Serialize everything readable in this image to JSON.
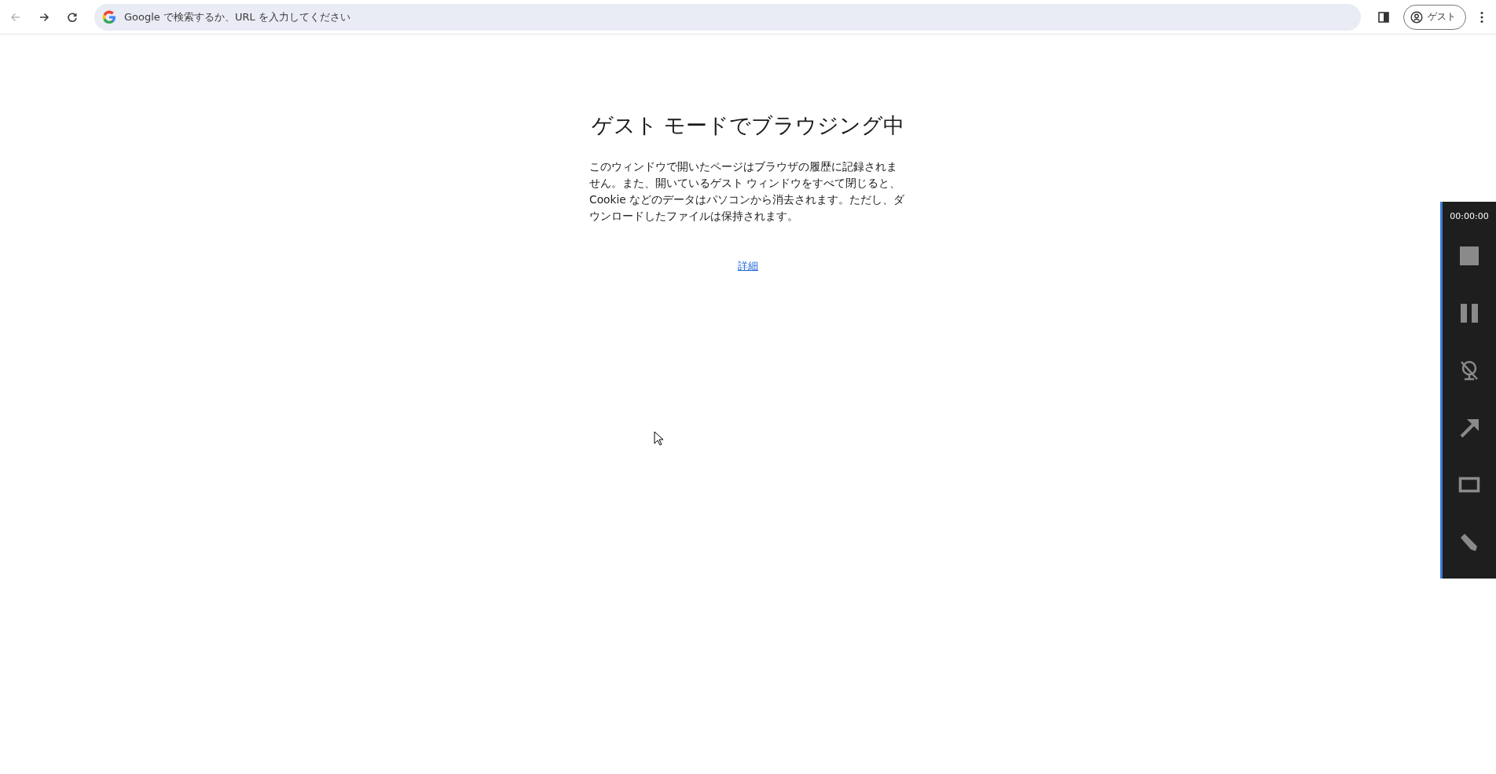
{
  "toolbar": {
    "nav_buttons": [
      {
        "kind": "back",
        "disabled": true
      },
      {
        "kind": "forward",
        "disabled": false
      },
      {
        "kind": "reload",
        "disabled": false
      }
    ],
    "omnibox": {
      "placeholder": "Google で検索するか、URL を入力してください"
    },
    "profile": {
      "label": "ゲスト"
    }
  },
  "page": {
    "heading": "ゲスト モードでブラウジング中",
    "body": "このウィンドウで開いたページはブラウザの履歴に記録されません。また、開いているゲスト ウィンドウをすべて閉じると、Cookie などのデータはパソコンから消去されます。ただし、ダウンロードしたファイルは保持されます。",
    "link": "詳細"
  },
  "recorder": {
    "time": "00:00:00",
    "tools": [
      {
        "kind": "stop"
      },
      {
        "kind": "pause"
      },
      {
        "kind": "camera-off"
      },
      {
        "kind": "arrow"
      },
      {
        "kind": "rectangle"
      },
      {
        "kind": "pen"
      }
    ]
  }
}
